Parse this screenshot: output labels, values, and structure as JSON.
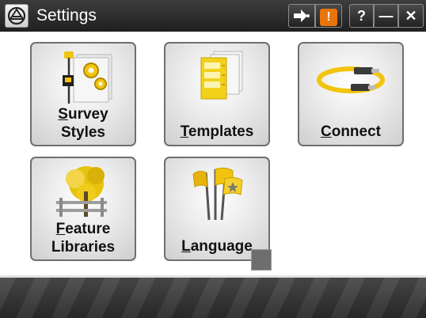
{
  "titlebar": {
    "title": "Settings",
    "app_icon": "trimble-logo-icon",
    "buttons": {
      "switch_icon": "switch-app-icon",
      "alert_icon": "alert-icon",
      "alert_glyph": "!",
      "help": "?",
      "minimize": "—",
      "close": "✕"
    }
  },
  "tiles": [
    {
      "icon": "survey-styles-icon",
      "label_lines": [
        "Survey",
        "Styles"
      ],
      "mnemonic": "S",
      "mnemonic_rest": "urvey"
    },
    {
      "icon": "templates-icon",
      "label_lines": [
        "Templates"
      ],
      "mnemonic": "T",
      "mnemonic_rest": "emplates"
    },
    {
      "icon": "connect-icon",
      "label_lines": [
        "Connect"
      ],
      "mnemonic": "C",
      "mnemonic_rest": "onnect"
    },
    {
      "icon": "feature-libraries-icon",
      "label_lines": [
        "Feature",
        "Libraries"
      ],
      "mnemonic": "F",
      "mnemonic_rest": "eature"
    },
    {
      "icon": "language-icon",
      "label_lines": [
        "Language"
      ],
      "mnemonic": "L",
      "mnemonic_rest": "anguage"
    }
  ],
  "colors": {
    "accent_yellow": "#f2c40f",
    "alert_orange": "#e8740c",
    "titlebar_dark": "#2b2b2b"
  }
}
